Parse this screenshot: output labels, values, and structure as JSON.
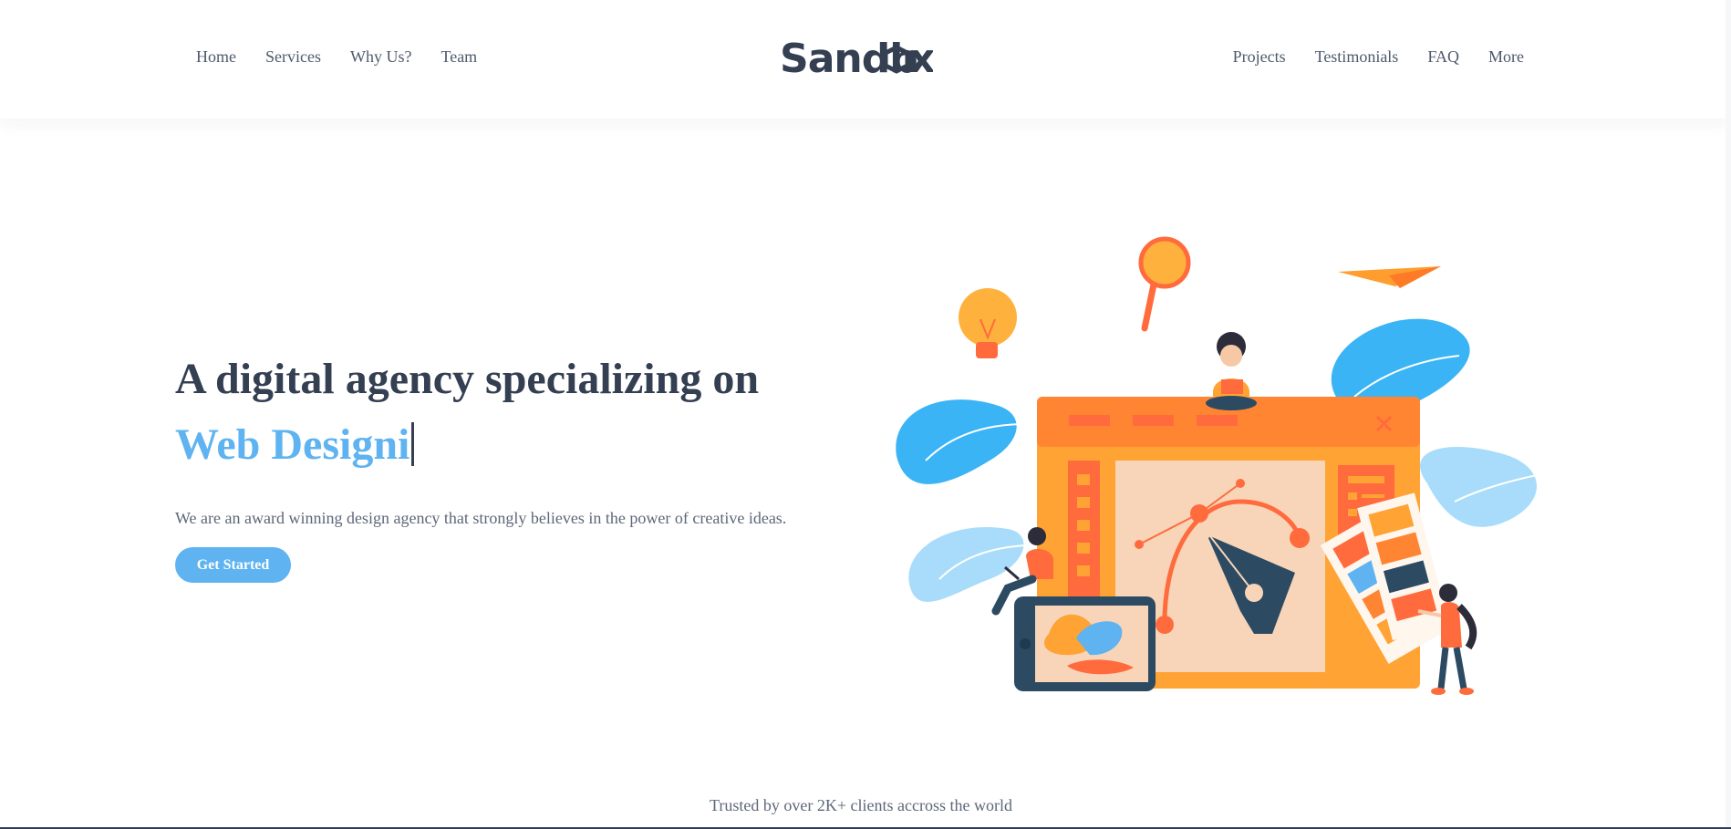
{
  "nav": {
    "left": [
      "Home",
      "Services",
      "Why Us?",
      "Team"
    ],
    "right": [
      "Projects",
      "Testimonials",
      "FAQ",
      "More"
    ],
    "logo": "Sandbox"
  },
  "hero": {
    "title": "A digital agency specializing on",
    "typed": "Web Designi",
    "subtitle": "We are an award winning design agency that strongly believes in the power of creative ideas.",
    "cta": "Get Started"
  },
  "trusted": "Trusted by over 2K+ clients accross the world",
  "colors": {
    "accent": "#5eb3f0",
    "heading": "#343f52",
    "orange": "#ff8533",
    "blue": "#3ab4f5"
  },
  "illustration": "design-agency-illustration"
}
